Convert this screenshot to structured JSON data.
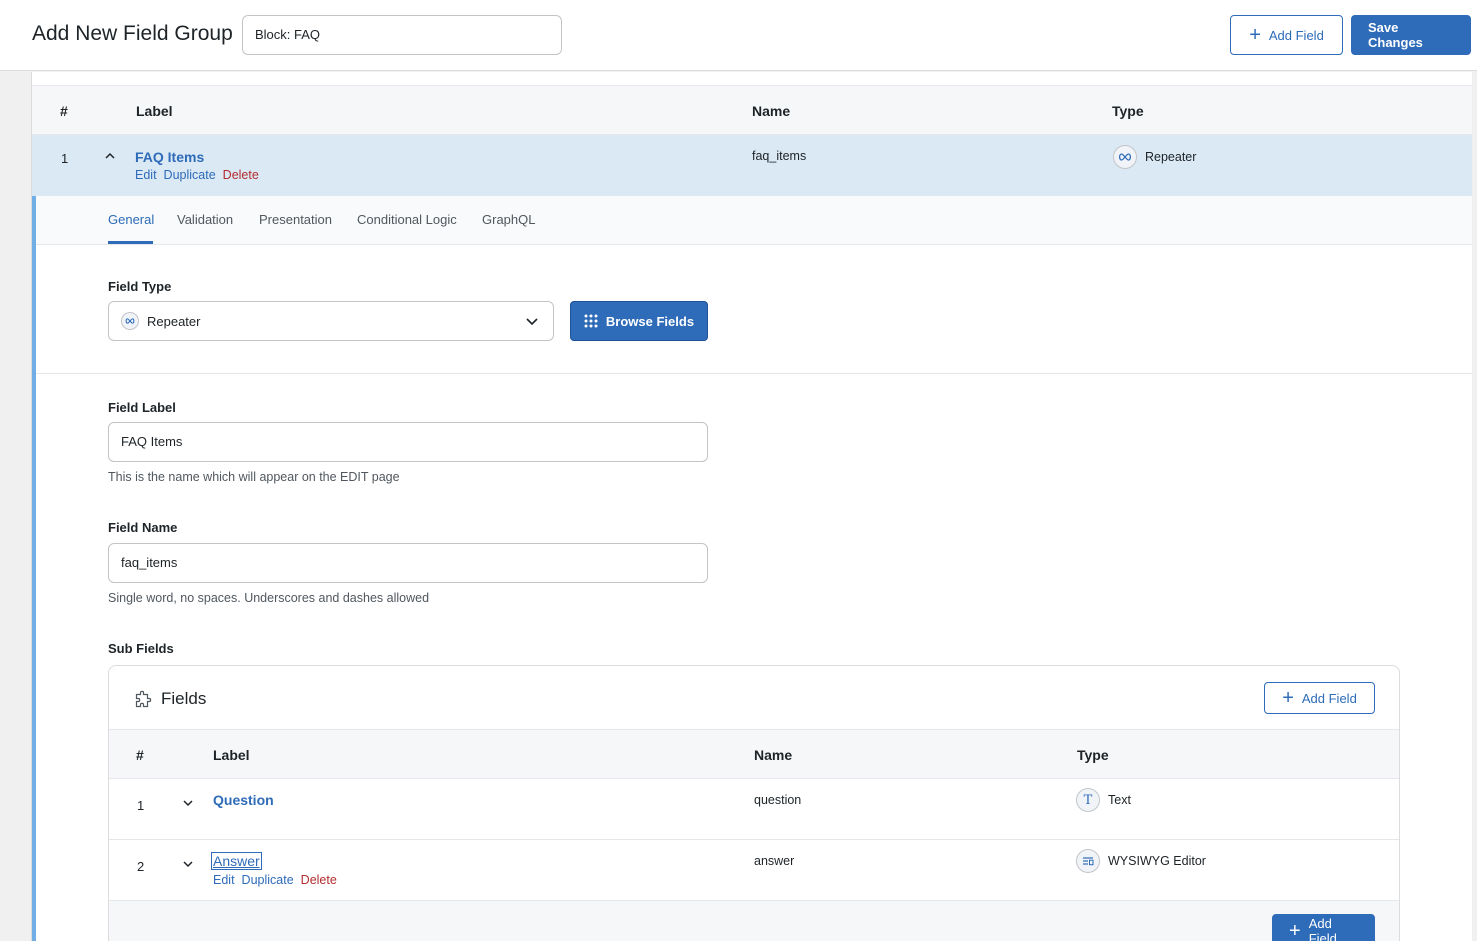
{
  "header": {
    "title": "Add New Field Group",
    "group_title_value": "Block: FAQ",
    "add_field_label": "Add Field",
    "save_label": "Save Changes"
  },
  "table": {
    "columns": [
      "#",
      "Label",
      "Name",
      "Type"
    ],
    "rows": [
      {
        "num": "1",
        "label": "FAQ Items",
        "actions": [
          "Edit",
          "Duplicate",
          "Delete"
        ],
        "name": "faq_items",
        "type": "Repeater",
        "type_icon": "infinity-icon"
      }
    ]
  },
  "settings": {
    "tabs": [
      "General",
      "Validation",
      "Presentation",
      "Conditional Logic",
      "GraphQL"
    ],
    "active_tab": "General",
    "field_type": {
      "label": "Field Type",
      "value": "Repeater",
      "browse_label": "Browse Fields"
    },
    "field_label": {
      "label": "Field Label",
      "value": "FAQ Items",
      "help": "This is the name which will appear on the EDIT page"
    },
    "field_name": {
      "label": "Field Name",
      "value": "faq_items",
      "help": "Single word, no spaces. Underscores and dashes allowed"
    },
    "sub_fields": {
      "label": "Sub Fields",
      "box_title": "Fields",
      "add_field_label": "Add Field",
      "columns": [
        "#",
        "Label",
        "Name",
        "Type"
      ],
      "rows": [
        {
          "num": "1",
          "label": "Question",
          "name": "question",
          "type": "Text",
          "type_icon": "text-t-icon"
        },
        {
          "num": "2",
          "label": "Answer",
          "name": "answer",
          "type": "WYSIWYG Editor",
          "type_icon": "wysiwyg-icon",
          "actions": [
            "Edit",
            "Duplicate",
            "Delete"
          ]
        }
      ],
      "footer_add_label": "Add Field"
    }
  },
  "colors": {
    "primary": "#2e6bb8",
    "active_row": "#dbe9f5",
    "delete": "#b32d2e",
    "accent_border": "#72aee6"
  }
}
